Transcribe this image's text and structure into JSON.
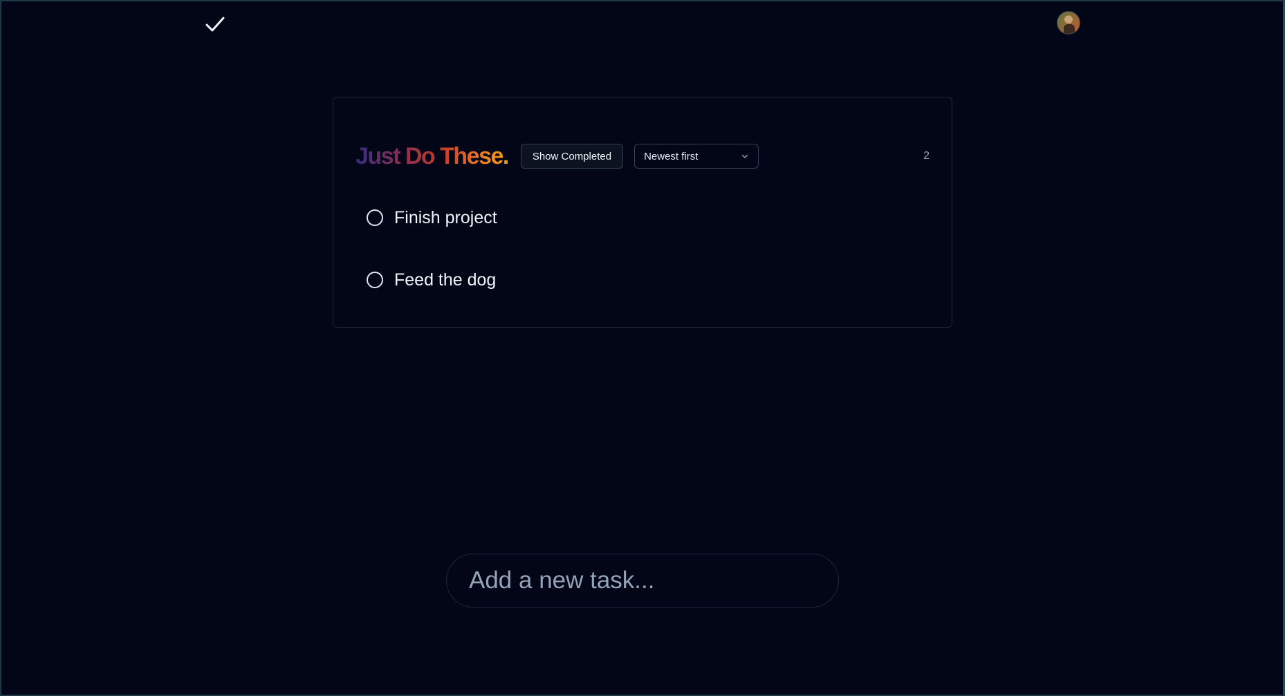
{
  "header": {
    "logo_icon": "checkmark-icon",
    "avatar_icon": "user-avatar"
  },
  "card": {
    "title": "Just Do These.",
    "show_completed_label": "Show Completed",
    "sort": {
      "selected": "Newest first",
      "icon": "chevron-down-icon"
    },
    "count": "2",
    "tasks": [
      {
        "label": "Finish project",
        "icon": "circle-icon"
      },
      {
        "label": "Feed the dog",
        "icon": "circle-icon"
      }
    ]
  },
  "add_task": {
    "placeholder": "Add a new task..."
  },
  "colors": {
    "background": "#020617",
    "border": "#1e293b",
    "title_gradient": [
      "#312e81",
      "#c0392b",
      "#f59e0b"
    ]
  }
}
